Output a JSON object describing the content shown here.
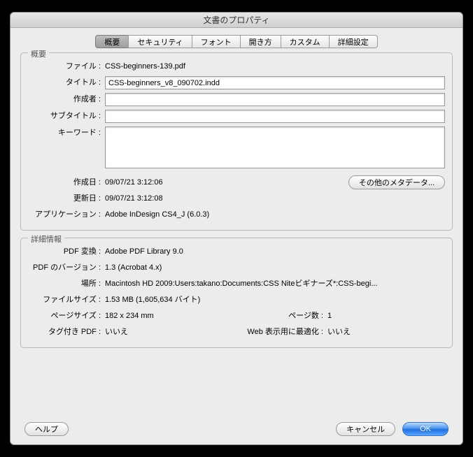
{
  "window": {
    "title": "文書のプロパティ"
  },
  "tabs": {
    "overview": "概要",
    "security": "セキュリティ",
    "fonts": "フォント",
    "initialview": "開き方",
    "custom": "カスタム",
    "advanced": "詳細設定"
  },
  "overview": {
    "legend": "概要",
    "file_label": "ファイル :",
    "file_value": "CSS-beginners-139.pdf",
    "title_label": "タイトル :",
    "title_value": "CSS-beginners_v8_090702.indd",
    "author_label": "作成者 :",
    "author_value": "",
    "subject_label": "サブタイトル :",
    "subject_value": "",
    "keywords_label": "キーワード :",
    "keywords_value": "",
    "created_label": "作成日 :",
    "created_value": "09/07/21 3:12:06",
    "modified_label": "更新日 :",
    "modified_value": "09/07/21 3:12:08",
    "app_label": "アプリケーション :",
    "app_value": "Adobe InDesign CS4_J (6.0.3)",
    "more_meta_btn": "その他のメタデータ..."
  },
  "details": {
    "legend": "詳細情報",
    "producer_label": "PDF 変換 :",
    "producer_value": "Adobe PDF Library 9.0",
    "version_label": "PDF のバージョン :",
    "version_value": "1.3 (Acrobat 4.x)",
    "location_label": "場所 :",
    "location_value": "Macintosh HD 2009:Users:takano:Documents:CSS Niteビギナーズ*:CSS-begi...",
    "filesize_label": "ファイルサイズ :",
    "filesize_value": "1.53 MB (1,605,634 バイト)",
    "pagesize_label": "ページサイズ :",
    "pagesize_value": "182 x 234 mm",
    "pagecount_label": "ページ数 :",
    "pagecount_value": "1",
    "tagged_label": "タグ付き PDF :",
    "tagged_value": "いいえ",
    "fastweb_label": "Web 表示用に最適化 :",
    "fastweb_value": "いいえ"
  },
  "buttons": {
    "help": "ヘルプ",
    "cancel": "キャンセル",
    "ok": "OK"
  }
}
